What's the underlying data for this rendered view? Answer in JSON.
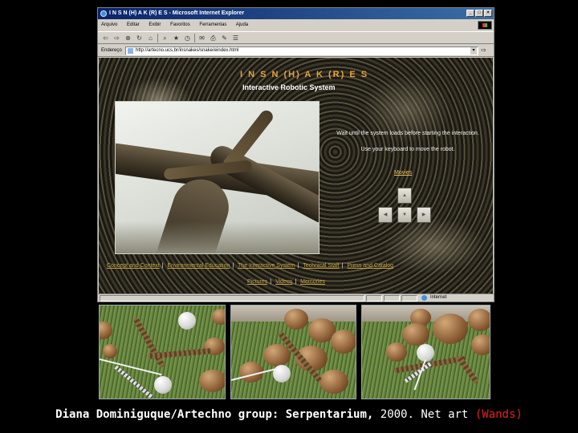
{
  "window": {
    "title": "I N S N (H) A K (R) E S - Microsoft Internet Explorer",
    "controls": [
      "_",
      "□",
      "×"
    ]
  },
  "menu": [
    "Arquivo",
    "Editar",
    "Exibir",
    "Favoritos",
    "Ferramentas",
    "Ajuda"
  ],
  "toolbar_icons": [
    "back-icon",
    "forward-icon",
    "stop-icon",
    "refresh-icon",
    "home-icon",
    "search-icon",
    "favorites-icon",
    "history-icon",
    "mail-icon",
    "print-icon",
    "edit-icon",
    "discuss-icon"
  ],
  "address": {
    "label": "Endereço",
    "url": "http://artecno.ucs.br/insnakes/snake/eindex.html"
  },
  "page": {
    "title": "I N S N (H) A K (R) E S",
    "subtitle": "Interactive Robotic System",
    "instruction_1": "Wait until the system loads before starting the interaction.",
    "instruction_2": "Use your keyboard to move the robot.",
    "movies_link": "Movies",
    "nav_row1": [
      "Concept and Context",
      "Environmental Education",
      "The Interactive System",
      "Technical Staff",
      "Press and Catalog"
    ],
    "nav_row2": [
      "Pictures",
      "Videos",
      "Memories"
    ]
  },
  "status": {
    "zone": "Internet"
  },
  "caption": {
    "author": "Diana Dominiguque/Artechno group: Serpentarium,",
    "year": "2000.",
    "medium": "Net art",
    "tag": "(Wands)"
  }
}
